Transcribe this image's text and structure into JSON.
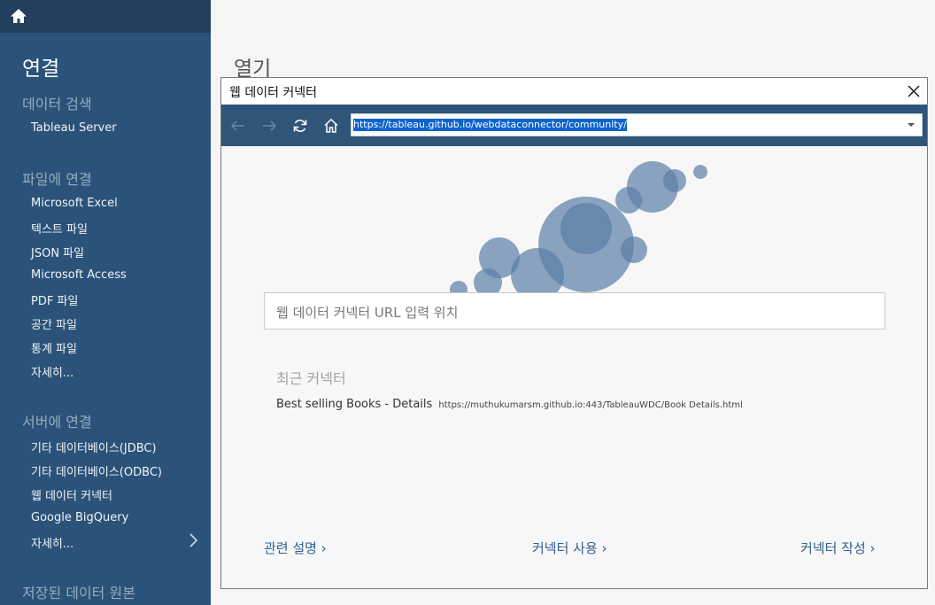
{
  "sidebar": {
    "connect_title": "연결",
    "search_section": "데이터 검색",
    "search_items": [
      "Tableau Server"
    ],
    "file_section": "파일에 연결",
    "file_items": [
      "Microsoft Excel",
      "텍스트 파일",
      "JSON 파일",
      "Microsoft Access",
      "PDF 파일",
      "공간 파일",
      "통계 파일",
      "자세히..."
    ],
    "server_section": "서버에 연결",
    "server_items": [
      "기타 데이터베이스(JDBC)",
      "기타 데이터베이스(ODBC)",
      "웹 데이터 커넥터",
      "Google BigQuery",
      "자세히..."
    ],
    "saved_section": "저장된 데이터 원본"
  },
  "main": {
    "title": "열기"
  },
  "dialog": {
    "title": "웹 데이터 커넥터",
    "url_value": "https://tableau.github.io/webdataconnector/community/",
    "input_placeholder": "웹 데이터 커넥터 URL 입력 위치",
    "recent_heading": "최근 커넥터",
    "recent": [
      {
        "name": "Best selling Books - Details",
        "url": "https://muthukumarsm.github.io:443/TableauWDC/Book Details.html"
      }
    ],
    "links": [
      "관련 설명 ›",
      "커넥터 사용 ›",
      "커넥터 작성 ›"
    ]
  },
  "colors": {
    "sidebar": "#2b5278",
    "bubble": "#5a7ea6",
    "link": "#2f6290"
  }
}
